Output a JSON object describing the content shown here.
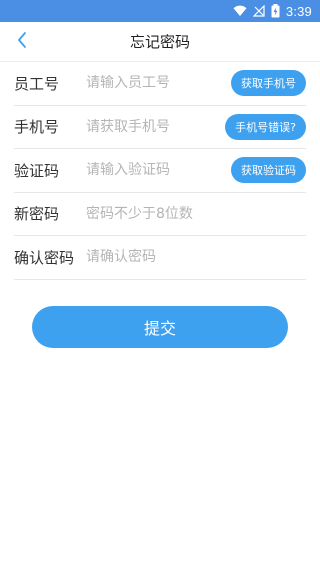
{
  "status_bar": {
    "time": "3:39",
    "icons": [
      "wifi-icon",
      "signal-icon",
      "battery-charging-icon"
    ]
  },
  "nav": {
    "title": "忘记密码",
    "back_icon": "chevron-left-icon"
  },
  "form": {
    "rows": [
      {
        "label": "员工号",
        "placeholder": "请输入员工号",
        "value": "",
        "button": "获取手机号"
      },
      {
        "label": "手机号",
        "placeholder": "请获取手机号",
        "value": "",
        "button": "手机号错误?"
      },
      {
        "label": "验证码",
        "placeholder": "请输入验证码",
        "value": "",
        "button": "获取验证码"
      },
      {
        "label": "新密码",
        "placeholder": "密码不少于8位数",
        "value": ""
      },
      {
        "label": "确认密码",
        "placeholder": "请确认密码",
        "value": ""
      }
    ]
  },
  "submit_label": "提交",
  "colors": {
    "status_bar": "#4a8fe3",
    "accent": "#3ea1f0",
    "placeholder": "#b5b5b5"
  }
}
